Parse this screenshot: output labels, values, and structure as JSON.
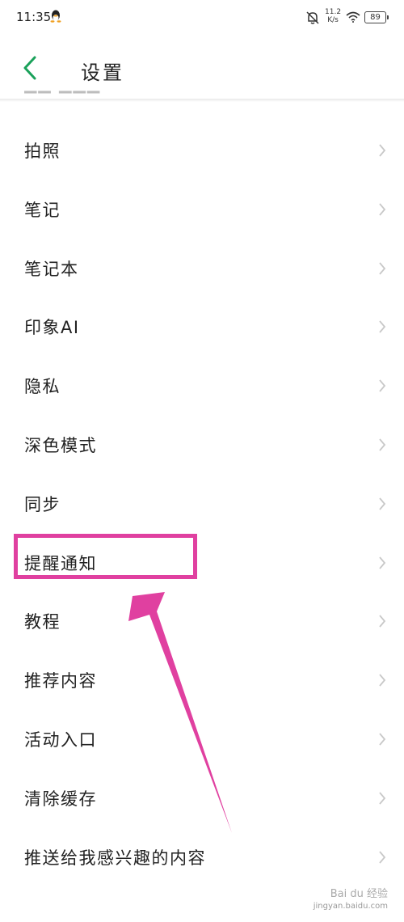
{
  "status_bar": {
    "time": "11:35",
    "speed_value": "11.2",
    "speed_unit": "K/s",
    "battery": "89"
  },
  "header": {
    "title": "设置"
  },
  "list": {
    "items": [
      {
        "label": "拍照"
      },
      {
        "label": "笔记"
      },
      {
        "label": "笔记本"
      },
      {
        "label": "印象AI"
      },
      {
        "label": "隐私"
      },
      {
        "label": "深色模式"
      },
      {
        "label": "同步"
      },
      {
        "label": "提醒通知"
      },
      {
        "label": "教程"
      },
      {
        "label": "推荐内容"
      },
      {
        "label": "活动入口"
      },
      {
        "label": "清除缓存"
      },
      {
        "label": "推送给我感兴趣的内容"
      }
    ]
  },
  "annotation": {
    "color": "#e040a0",
    "highlighted_item": "提醒通知"
  },
  "colors": {
    "accent": "#1aa15a"
  },
  "watermark": {
    "brand": "Bai du 经验",
    "domain": "jingyan.baidu.com"
  }
}
